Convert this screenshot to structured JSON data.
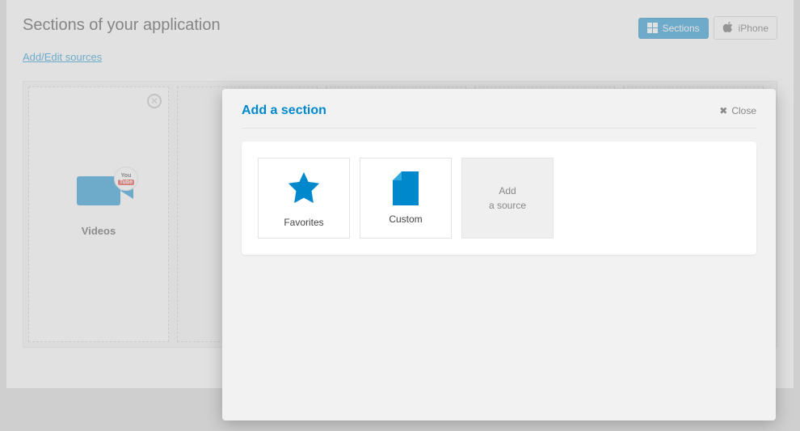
{
  "header": {
    "title": "Sections of your application",
    "sections_btn": "Sections",
    "iphone_btn": "iPhone"
  },
  "link_text": "Add/Edit sources",
  "card": {
    "label": "Videos",
    "youtube_you": "You",
    "youtube_tube": "Tube"
  },
  "ghost_text": "Add",
  "modal": {
    "title": "Add a section",
    "close": "Close",
    "tiles": {
      "favorites": "Favorites",
      "custom": "Custom",
      "add_line1": "Add",
      "add_line2": "a source"
    }
  }
}
